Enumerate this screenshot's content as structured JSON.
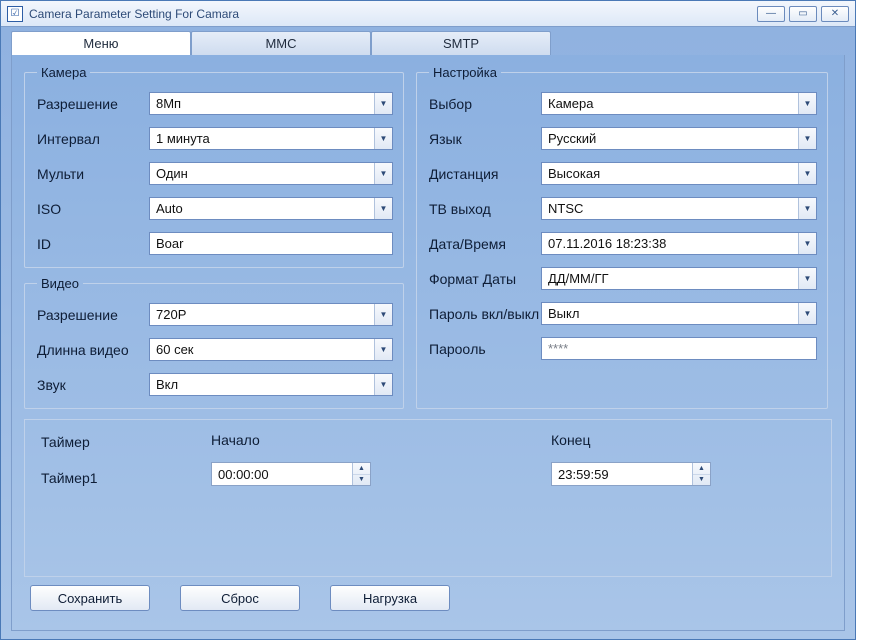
{
  "window": {
    "title": "Camera Parameter Setting For  Camara"
  },
  "tabs": {
    "menu": "Меню",
    "mmc": "MMC",
    "smtp": "SMTP"
  },
  "groups": {
    "camera": "Камера",
    "video": "Видео",
    "settings": "Настройка"
  },
  "camera": {
    "resolution_label": "Разрешение",
    "resolution": "8Мп",
    "interval_label": "Интервал",
    "interval": "1 минута",
    "multi_label": "Мульти",
    "multi": "Один",
    "iso_label": "ISO",
    "iso": "Auto",
    "id_label": "ID",
    "id": "Boar"
  },
  "video": {
    "resolution_label": "Разрешение",
    "resolution": "720P",
    "duration_label": "Длинна видео",
    "duration": "60 сек",
    "sound_label": "Звук",
    "sound": "Вкл"
  },
  "settings": {
    "mode_label": "Выбор",
    "mode": "Камера",
    "language_label": "Язык",
    "language": "Русский",
    "distance_label": "Дистанция",
    "distance": "Высокая",
    "tvout_label": "ТВ выход",
    "tvout": "NTSC",
    "datetime_label": "Дата/Время",
    "datetime": "07.11.2016 18:23:38",
    "datefmt_label": "Формат Даты",
    "datefmt": "ДД/ММ/ГГ",
    "pwd_toggle_label": "Пароль вкл/выкл",
    "pwd_toggle": "Выкл",
    "pwd_label": "Пароοль",
    "pwd": "****"
  },
  "timer": {
    "title": "Таймер",
    "row1": "Таймер1",
    "start_label": "Начало",
    "start": "00:00:00",
    "end_label": "Конец",
    "end": "23:59:59"
  },
  "buttons": {
    "save": "Сохранить",
    "reset": "Сброс",
    "load": "Нагрузка"
  }
}
